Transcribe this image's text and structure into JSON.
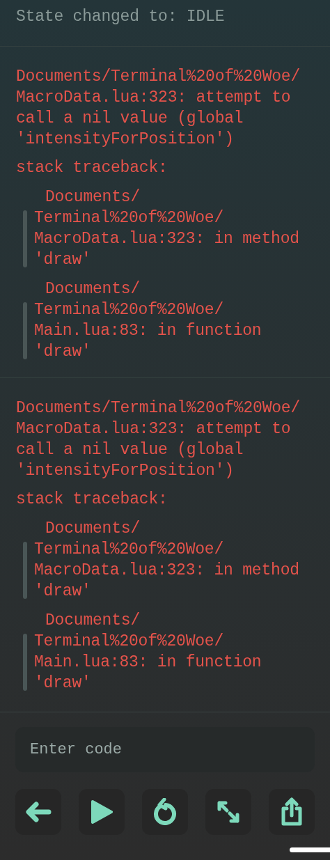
{
  "log": [
    {
      "kind": "info",
      "lines": [
        "State changed to: IDLE"
      ]
    },
    {
      "kind": "error",
      "lines": [
        "Documents/Terminal%20of%20Woe/",
        "MacroData.lua:323: attempt to",
        "call a nil value (global",
        "'intensityForPosition')"
      ],
      "traceback_title": "stack traceback:",
      "traceback": [
        {
          "head": "Documents/",
          "lines": [
            "Terminal%20of%20Woe/",
            "MacroData.lua:323: in method",
            "'draw'"
          ]
        },
        {
          "head": "Documents/",
          "lines": [
            "Terminal%20of%20Woe/",
            "Main.lua:83: in function",
            "'draw'"
          ]
        }
      ]
    },
    {
      "kind": "error",
      "lines": [
        "Documents/Terminal%20of%20Woe/",
        "MacroData.lua:323: attempt to",
        "call a nil value (global",
        "'intensityForPosition')"
      ],
      "traceback_title": "stack traceback:",
      "traceback": [
        {
          "head": "Documents/",
          "lines": [
            "Terminal%20of%20Woe/",
            "MacroData.lua:323: in method",
            "'draw'"
          ]
        },
        {
          "head": "Documents/",
          "lines": [
            "Terminal%20of%20Woe/",
            "Main.lua:83: in function",
            "'draw'"
          ]
        }
      ]
    }
  ],
  "input": {
    "placeholder": "Enter code"
  },
  "buttons": [
    {
      "kind": "back"
    },
    {
      "kind": "play"
    },
    {
      "kind": "restart"
    },
    {
      "kind": "resize"
    },
    {
      "kind": "share"
    }
  ]
}
